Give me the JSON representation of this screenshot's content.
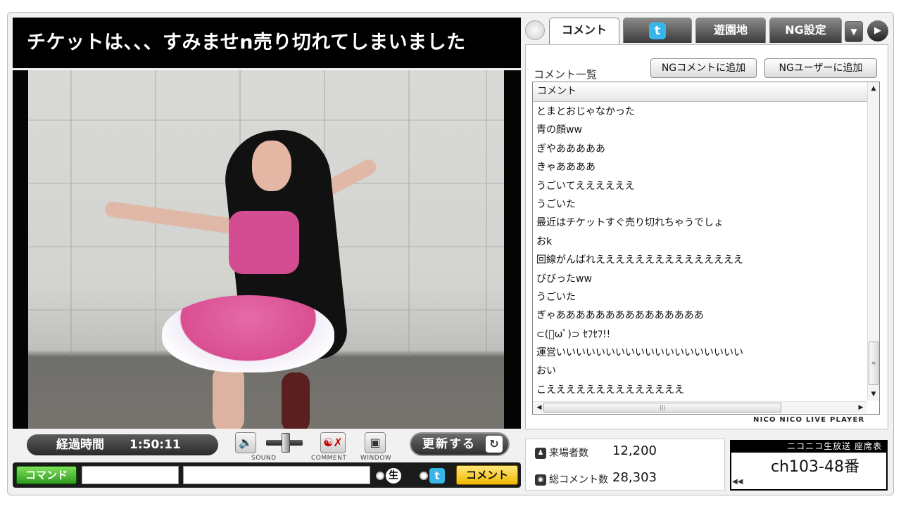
{
  "stream": {
    "title": "チケットは、、、すみませn売り切れてしまいました"
  },
  "controls": {
    "elapsed_label": "経過時間",
    "elapsed_time": "1:50:11",
    "sound_caption": "SOUND",
    "comment_caption": "COMMENT",
    "window_caption": "WINDOW",
    "refresh_label": "更新する",
    "volume_level": 0.55
  },
  "command_bar": {
    "command_label": "コマンド",
    "command_value": "",
    "comment_value": "",
    "live_label": "生",
    "twitter_label": "t",
    "submit_label": "コメント"
  },
  "tabs": [
    {
      "label": "コメント",
      "active": true
    },
    {
      "label": "t",
      "icon": "twitter-icon",
      "active": false
    },
    {
      "label": "遊園地",
      "active": false
    },
    {
      "label": "NG設定",
      "active": false
    }
  ],
  "comment_panel": {
    "title": "コメント一覧",
    "ng_comment_button": "NGコメントに追加",
    "ng_user_button": "NGユーザーに追加",
    "column_header": "コメント",
    "comments": [
      "とまとおじゃなかった",
      "青の顔ww",
      "ぎやあああああ",
      "きゃああああ",
      "うごいてええええええ",
      "うごいた",
      "最近はチケットすぐ売り切れちゃうでしょ",
      "おk",
      "回線がんばれえええええええええええええええ",
      "びびったww",
      "うごいた",
      "ぎゃあああああああああああああああ",
      "⊂(ﾟωﾟ)⊃ ｾﾌｾﾌ!!",
      "運営いいいいいいいいいいいいいいいいいいい",
      "おい",
      "こええええええええええええええ"
    ],
    "brand": "NICO NICO LIVE PLAYER"
  },
  "stats": {
    "visitors_label": "来場者数",
    "visitors_value": "12,200",
    "comments_label": "総コメント数",
    "comments_value": "28,303"
  },
  "seat": {
    "header": "ニコニコ生放送 座席表",
    "value": "ch103-48番"
  },
  "colors": {
    "command_green": "#2f9a1e",
    "submit_yellow": "#f0b800",
    "twitter_blue": "#39b6e8"
  }
}
